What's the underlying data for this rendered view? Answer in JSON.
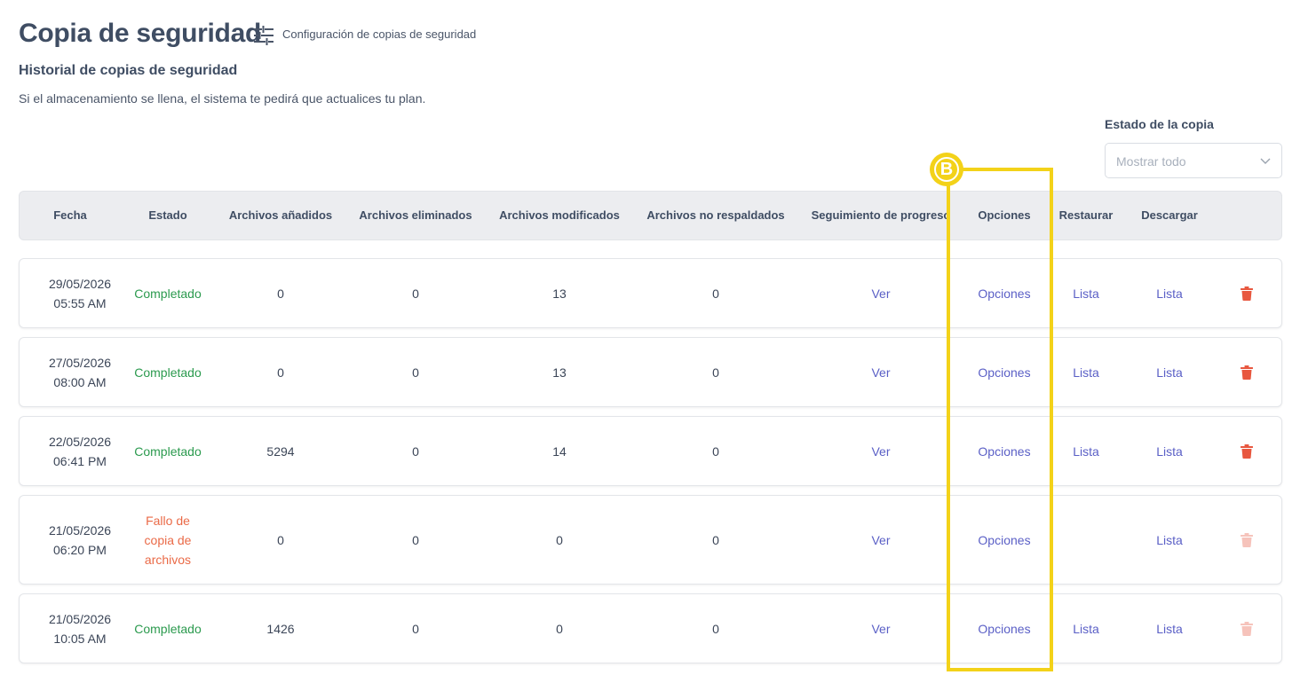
{
  "header": {
    "title": "Copia de seguridad",
    "settings_link": "Configuración de copias de seguridad",
    "settings_icon": "sliders-icon"
  },
  "history": {
    "title": "Historial de copias de seguridad",
    "description": "Si el almacenamiento se llena, el sistema te pedirá que actualices tu plan."
  },
  "filter": {
    "label": "Estado de la copia",
    "placeholder": "Mostrar todo"
  },
  "table": {
    "columns": [
      "Fecha",
      "Estado",
      "Archivos añadidos",
      "Archivos eliminados",
      "Archivos modificados",
      "Archivos no respaldados",
      "Seguimiento de progreso",
      "Opciones",
      "Restaurar",
      "Descargar"
    ],
    "rows": [
      {
        "date": "29/05/2026",
        "time": "05:55 AM",
        "status": "Completado",
        "added": "0",
        "deleted": "0",
        "modified": "13",
        "not_backed": "0",
        "progress": "Ver",
        "options": "Opciones",
        "restore": "Lista",
        "download": "Lista"
      },
      {
        "date": "27/05/2026",
        "time": "08:00 AM",
        "status": "Completado",
        "added": "0",
        "deleted": "0",
        "modified": "13",
        "not_backed": "0",
        "progress": "Ver",
        "options": "Opciones",
        "restore": "Lista",
        "download": "Lista"
      },
      {
        "date": "22/05/2026",
        "time": "06:41 PM",
        "status": "Completado",
        "added": "5294",
        "deleted": "0",
        "modified": "14",
        "not_backed": "0",
        "progress": "Ver",
        "options": "Opciones",
        "restore": "Lista",
        "download": "Lista"
      },
      {
        "date": "21/05/2026",
        "time": "06:20 PM",
        "status": "Fallo de copia de archivos",
        "added": "0",
        "deleted": "0",
        "modified": "0",
        "not_backed": "0",
        "progress": "Ver",
        "options": "Opciones",
        "restore": "",
        "download": "Lista"
      },
      {
        "date": "21/05/2026",
        "time": "10:05 AM",
        "status": "Completado",
        "added": "1426",
        "deleted": "0",
        "modified": "0",
        "not_backed": "0",
        "progress": "Ver",
        "options": "Opciones",
        "restore": "Lista",
        "download": "Lista"
      }
    ]
  },
  "annotation": {
    "badge": "B",
    "color": "#f3d219"
  },
  "colors": {
    "success": "#2b9a4e",
    "error": "#ea6a47",
    "link": "#5a5fc6",
    "trash": "#e8573f"
  }
}
